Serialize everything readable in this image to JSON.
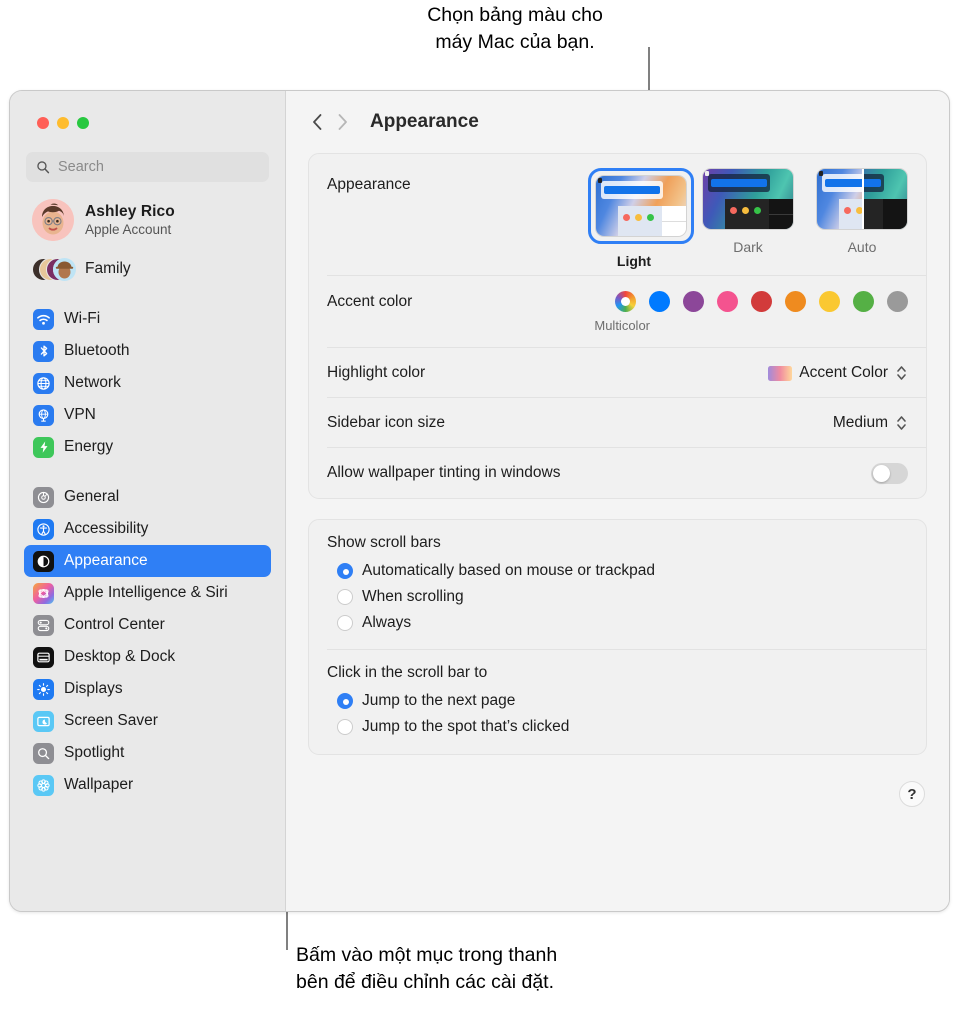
{
  "callouts": {
    "top": "Chọn bảng màu cho\nmáy Mac của bạn.",
    "bottom": "Bấm vào một mục trong thanh\nbên để điều chỉnh các cài đặt."
  },
  "window": {
    "traffic_lights": [
      "close-red",
      "minimize-yellow",
      "zoom-green"
    ]
  },
  "sidebar": {
    "search": {
      "placeholder": "Search",
      "icon": "search-icon"
    },
    "account": {
      "name": "Ashley Rico",
      "subtitle": "Apple Account",
      "avatar": "memoji-avatar"
    },
    "family": {
      "label": "Family",
      "icon": "family-avatars"
    },
    "groups": [
      {
        "items": [
          {
            "label": "Wi-Fi",
            "icon": "wifi-icon",
            "color": "#2a7bf0",
            "selected": false
          },
          {
            "label": "Bluetooth",
            "icon": "bluetooth-icon",
            "color": "#2a7bf0",
            "selected": false
          },
          {
            "label": "Network",
            "icon": "globe-icon",
            "color": "#2a7bf0",
            "selected": false
          },
          {
            "label": "VPN",
            "icon": "vpn-globe-icon",
            "color": "#2a7bf0",
            "selected": false
          },
          {
            "label": "Energy",
            "icon": "bolt-icon",
            "color": "#3ec75a",
            "selected": false
          }
        ]
      },
      {
        "items": [
          {
            "label": "General",
            "icon": "gear-icon",
            "color": "#8e8e93",
            "selected": false
          },
          {
            "label": "Accessibility",
            "icon": "accessibility-icon",
            "color": "#1f7af2",
            "selected": false
          },
          {
            "label": "Appearance",
            "icon": "appearance-icon",
            "color": "#111111",
            "selected": true
          },
          {
            "label": "Apple Intelligence & Siri",
            "icon": "siri-icon",
            "color": "#e86ab0",
            "selected": false
          },
          {
            "label": "Control Center",
            "icon": "control-center-icon",
            "color": "#8e8e93",
            "selected": false
          },
          {
            "label": "Desktop & Dock",
            "icon": "desktop-dock-icon",
            "color": "#111111",
            "selected": false
          },
          {
            "label": "Displays",
            "icon": "brightness-icon",
            "color": "#1f7af2",
            "selected": false
          },
          {
            "label": "Screen Saver",
            "icon": "screen-saver-icon",
            "color": "#5ac8f5",
            "selected": false
          },
          {
            "label": "Spotlight",
            "icon": "spotlight-search-icon",
            "color": "#8e8e93",
            "selected": false
          },
          {
            "label": "Wallpaper",
            "icon": "wallpaper-icon",
            "color": "#5ac8f5",
            "selected": false
          }
        ]
      }
    ]
  },
  "toolbar": {
    "back": "back-chevron",
    "forward": "forward-chevron",
    "title": "Appearance"
  },
  "appearance_card": {
    "appearance": {
      "label": "Appearance",
      "modes": [
        {
          "label": "Light",
          "selected": true
        },
        {
          "label": "Dark",
          "selected": false
        },
        {
          "label": "Auto",
          "selected": false
        }
      ]
    },
    "accent": {
      "label": "Accent color",
      "caption": "Multicolor",
      "swatches": [
        {
          "name": "multicolor",
          "color": "multicolor"
        },
        {
          "name": "blue",
          "color": "#007aff"
        },
        {
          "name": "purple",
          "color": "#8c4799"
        },
        {
          "name": "pink",
          "color": "#f4538f"
        },
        {
          "name": "red",
          "color": "#d23b3b"
        },
        {
          "name": "orange",
          "color": "#ef8b1f"
        },
        {
          "name": "yellow",
          "color": "#fac831"
        },
        {
          "name": "green",
          "color": "#55b045"
        },
        {
          "name": "graphite",
          "color": "#9a9a9a"
        }
      ]
    },
    "highlight": {
      "label": "Highlight color",
      "value": "Accent Color"
    },
    "sidebar_icon_size": {
      "label": "Sidebar icon size",
      "value": "Medium"
    },
    "wallpaper_tinting": {
      "label": "Allow wallpaper tinting in windows",
      "state": "off"
    }
  },
  "scroll_card": {
    "show_scroll_bars": {
      "label": "Show scroll bars",
      "options": [
        {
          "label": "Automatically based on mouse or trackpad",
          "selected": true
        },
        {
          "label": "When scrolling",
          "selected": false
        },
        {
          "label": "Always",
          "selected": false
        }
      ]
    },
    "click_scroll_bar": {
      "label": "Click in the scroll bar to",
      "options": [
        {
          "label": "Jump to the next page",
          "selected": true
        },
        {
          "label": "Jump to the spot that’s clicked",
          "selected": false
        }
      ]
    }
  },
  "help": {
    "label": "?"
  }
}
